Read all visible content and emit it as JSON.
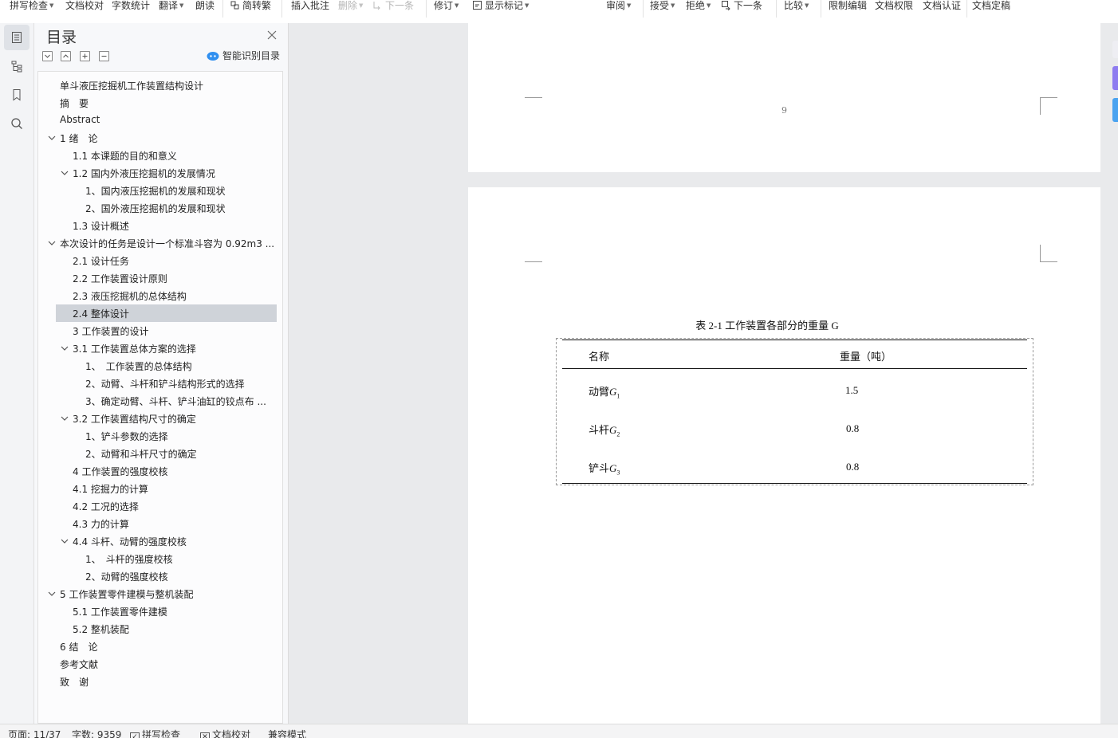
{
  "toolbar": {
    "spell_check": "拼写检查",
    "doc_proof": "文档校对",
    "word_count": "字数统计",
    "translate": "翻译",
    "read_aloud": "朗读",
    "trad_simplified": "简转繁",
    "insert_comment": "插入批注",
    "delete": "删除",
    "next_comment": "下一条",
    "track_changes": "修订",
    "show_markup": "显示标记",
    "review": "审阅",
    "accept": "接受",
    "reject": "拒绝",
    "next_change": "下一条",
    "compare": "比较",
    "restrict_edit": "限制编辑",
    "doc_permissions": "文档权限",
    "doc_certify": "文档认证",
    "doc_finalize": "文档定稿"
  },
  "outline": {
    "title": "目录",
    "smart_toc_label": "智能识别目录",
    "items": [
      {
        "label": "单斗液压挖掘机工作装置结构设计",
        "level": 0,
        "expanded": null,
        "selected": false
      },
      {
        "label": "摘　要",
        "level": 0,
        "expanded": null,
        "selected": false
      },
      {
        "label": "Abstract",
        "level": 0,
        "expanded": null,
        "selected": false
      },
      {
        "label": "1 绪　论",
        "level": 0,
        "expanded": true,
        "selected": false
      },
      {
        "label": "1.1 本课题的目的和意义",
        "level": 1,
        "expanded": null,
        "selected": false
      },
      {
        "label": "1.2 国内外液压挖掘机的发展情况",
        "level": 1,
        "expanded": true,
        "selected": false
      },
      {
        "label": "1、国内液压挖掘机的发展和现状",
        "level": 2,
        "expanded": null,
        "selected": false
      },
      {
        "label": "2、国外液压挖掘机的发展和现状",
        "level": 2,
        "expanded": null,
        "selected": false
      },
      {
        "label": "1.3 设计概述",
        "level": 1,
        "expanded": null,
        "selected": false
      },
      {
        "label": "本次设计的任务是设计一个标准斗容为 0.92m3 ...",
        "level": 0,
        "expanded": true,
        "selected": false
      },
      {
        "label": "2.1 设计任务",
        "level": 1,
        "expanded": null,
        "selected": false
      },
      {
        "label": "2.2 工作装置设计原则",
        "level": 1,
        "expanded": null,
        "selected": false
      },
      {
        "label": "2.3 液压挖掘机的总体结构",
        "level": 1,
        "expanded": null,
        "selected": false
      },
      {
        "label": "2.4 整体设计",
        "level": 1,
        "expanded": null,
        "selected": true
      },
      {
        "label": "3 工作装置的设计",
        "level": 1,
        "expanded": null,
        "selected": false
      },
      {
        "label": "3.1  工作装置总体方案的选择",
        "level": 1,
        "expanded": true,
        "selected": false
      },
      {
        "label": "1、　工作装置的总体结构",
        "level": 2,
        "expanded": null,
        "selected": false
      },
      {
        "label": "2、动臂、斗杆和铲斗结构形式的选择",
        "level": 2,
        "expanded": null,
        "selected": false
      },
      {
        "label": "3、确定动臂、斗杆、铲斗油缸的铰点布 ...",
        "level": 2,
        "expanded": null,
        "selected": false
      },
      {
        "label": "3.2 工作装置结构尺寸的确定",
        "level": 1,
        "expanded": true,
        "selected": false
      },
      {
        "label": "1、铲斗参数的选择",
        "level": 2,
        "expanded": null,
        "selected": false
      },
      {
        "label": "2、动臂和斗杆尺寸的确定",
        "level": 2,
        "expanded": null,
        "selected": false
      },
      {
        "label": "4 工作装置的强度校核",
        "level": 1,
        "expanded": null,
        "selected": false
      },
      {
        "label": "4.1 挖掘力的计算",
        "level": 1,
        "expanded": null,
        "selected": false
      },
      {
        "label": "4.2 工况的选择",
        "level": 1,
        "expanded": null,
        "selected": false
      },
      {
        "label": "4.3 力的计算",
        "level": 1,
        "expanded": null,
        "selected": false
      },
      {
        "label": "4.4 斗杆、动臂的强度校核",
        "level": 1,
        "expanded": true,
        "selected": false
      },
      {
        "label": "1、　斗杆的强度校核",
        "level": 2,
        "expanded": null,
        "selected": false
      },
      {
        "label": "2、动臂的强度校核",
        "level": 2,
        "expanded": null,
        "selected": false
      },
      {
        "label": "5 工作装置零件建模与整机装配",
        "level": 0,
        "expanded": true,
        "selected": false
      },
      {
        "label": "5.1 工作装置零件建模",
        "level": 1,
        "expanded": null,
        "selected": false
      },
      {
        "label": "5.2 整机装配",
        "level": 1,
        "expanded": null,
        "selected": false
      },
      {
        "label": "6 结　论",
        "level": 0,
        "expanded": null,
        "selected": false
      },
      {
        "label": "参考文献",
        "level": 0,
        "expanded": null,
        "selected": false
      },
      {
        "label": "致　谢",
        "level": 0,
        "expanded": null,
        "selected": false
      }
    ]
  },
  "document": {
    "page_number": "9",
    "table_caption": "表 2-1  工作装置各部分的重量 G",
    "table": {
      "headers": [
        "名称",
        "重量（吨）"
      ],
      "rows": [
        {
          "name": "动臂",
          "symbol": "G",
          "sub": "1",
          "value": "1.5"
        },
        {
          "name": "斗杆",
          "symbol": "G",
          "sub": "2",
          "value": "0.8"
        },
        {
          "name": "铲斗",
          "symbol": "G",
          "sub": "3",
          "value": "0.8"
        }
      ]
    }
  },
  "statusbar": {
    "page": "页面: 11/37",
    "words": "字数: 9359",
    "spell_check": "拼写检查",
    "doc_proof": "文档校对",
    "compat_mode": "兼容模式"
  },
  "colors": {
    "accent_blue": "#2f8ff0",
    "selected_row": "#cfd3d9",
    "strip_purple": "#8e7cf0",
    "strip_blue": "#4aa3f0"
  }
}
